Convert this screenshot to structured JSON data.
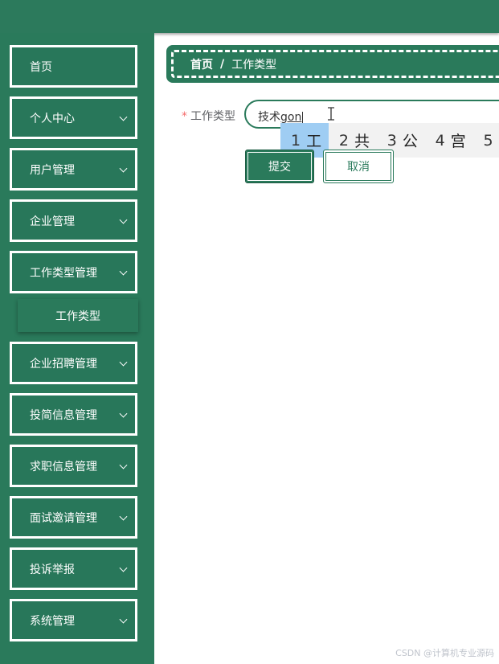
{
  "sidebar": {
    "items": [
      {
        "label": "首页",
        "has_chevron": false
      },
      {
        "label": "个人中心",
        "has_chevron": true
      },
      {
        "label": "用户管理",
        "has_chevron": true
      },
      {
        "label": "企业管理",
        "has_chevron": true
      },
      {
        "label": "工作类型管理",
        "has_chevron": true
      },
      {
        "label": "企业招聘管理",
        "has_chevron": true
      },
      {
        "label": "投简信息管理",
        "has_chevron": true
      },
      {
        "label": "求职信息管理",
        "has_chevron": true
      },
      {
        "label": "面试邀请管理",
        "has_chevron": true
      },
      {
        "label": "投诉举报",
        "has_chevron": true
      },
      {
        "label": "系统管理",
        "has_chevron": true
      }
    ],
    "submenu_label": "工作类型"
  },
  "breadcrumb": {
    "home": "首页",
    "separator": "/",
    "current": "工作类型"
  },
  "form": {
    "required_mark": "*",
    "field_label": "工作类型",
    "input_committed": "技术",
    "input_composing": "gon"
  },
  "ime": {
    "candidates": [
      {
        "num": "1",
        "text": "工",
        "selected": true
      },
      {
        "num": "2",
        "text": "共",
        "selected": false
      },
      {
        "num": "3",
        "text": "公",
        "selected": false
      },
      {
        "num": "4",
        "text": "宫",
        "selected": false
      },
      {
        "num": "5",
        "text": "",
        "selected": false
      }
    ]
  },
  "buttons": {
    "submit": "提交",
    "cancel": "取消"
  },
  "watermark": "CSDN @计算机专业源码",
  "colors": {
    "primary": "#2a7a5b",
    "required": "#f56c6c",
    "ime_highlight": "#9fcdf3"
  }
}
